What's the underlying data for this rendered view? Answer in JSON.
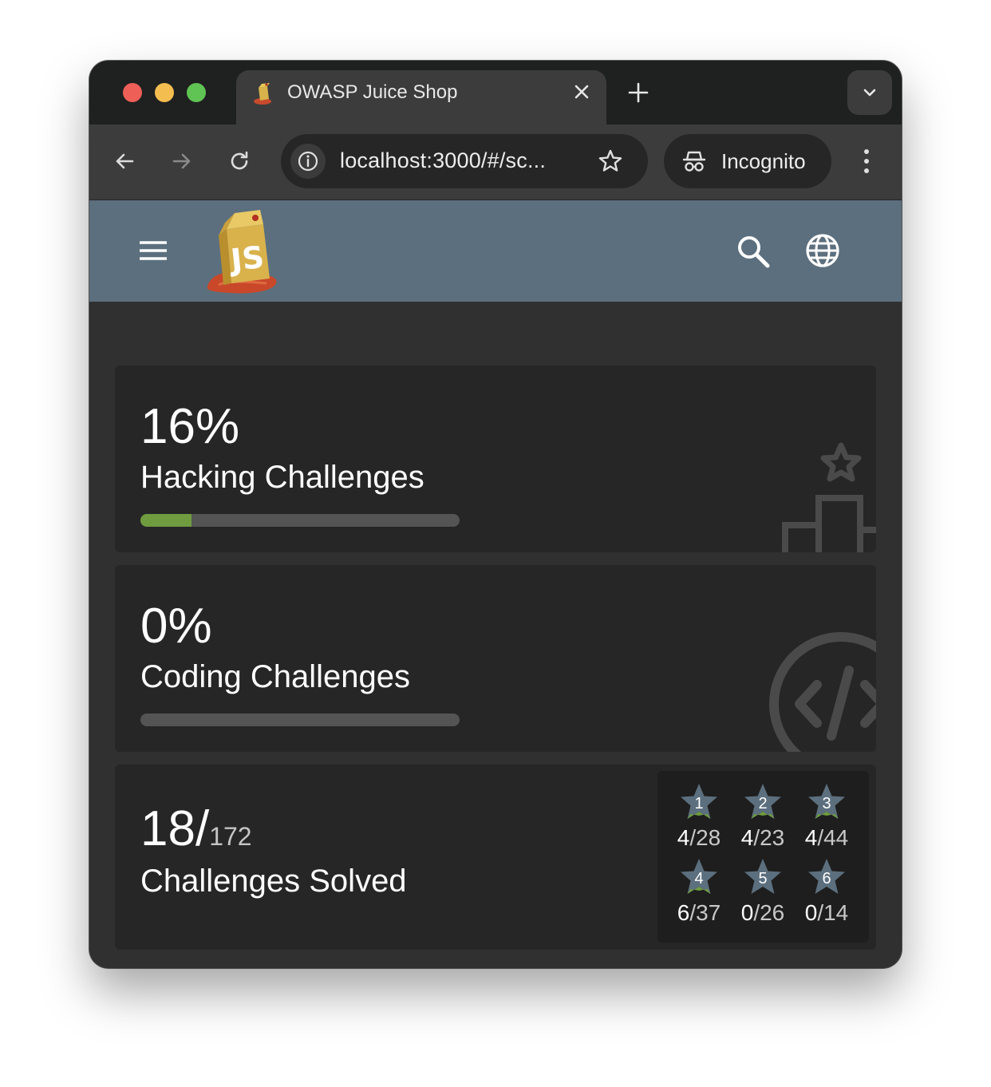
{
  "browser": {
    "tab_title": "OWASP Juice Shop",
    "url": "localhost:3000/#/sc...",
    "profile_label": "Incognito"
  },
  "app": {
    "logo_text": "JS"
  },
  "cards": {
    "hacking": {
      "percent_label": "16%",
      "label": "Hacking Challenges",
      "progress": 0.16
    },
    "coding": {
      "percent_label": "0%",
      "label": "Coding Challenges",
      "progress": 0.0
    },
    "solved": {
      "solved": "18/",
      "total": "172",
      "label": "Challenges Solved"
    }
  },
  "difficulties": [
    {
      "level": "1",
      "solved": "4",
      "total": "/28"
    },
    {
      "level": "2",
      "solved": "4",
      "total": "/23"
    },
    {
      "level": "3",
      "solved": "4",
      "total": "/44"
    },
    {
      "level": "4",
      "solved": "6",
      "total": "/37"
    },
    {
      "level": "5",
      "solved": "0",
      "total": "/26"
    },
    {
      "level": "6",
      "solved": "0",
      "total": "/14"
    }
  ],
  "colors": {
    "appbar": "#5c6f7e",
    "progress_fill": "#6f9c3f",
    "progress_track": "#545454",
    "card_bg": "#262626",
    "star": "#5c6f7e",
    "star_solved_accent": "#6f9c3f"
  }
}
